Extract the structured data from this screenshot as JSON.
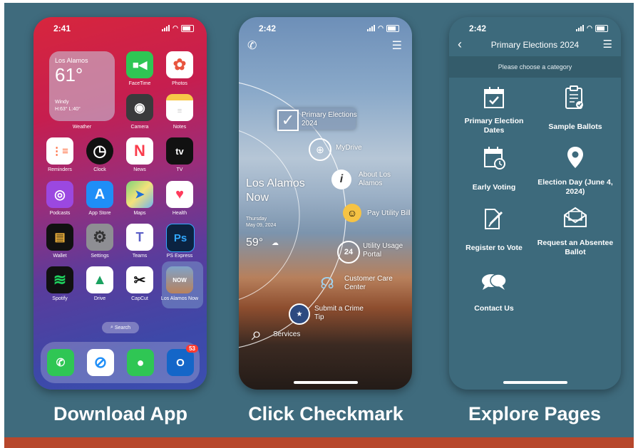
{
  "captions": [
    "Download App",
    "Click Checkmark",
    "Explore Pages"
  ],
  "phone1": {
    "time": "2:41",
    "weather": {
      "city": "Los Alamos",
      "temp": "61°",
      "condition": "Windy",
      "hilo": "H:63° L:40°",
      "label": "Weather"
    },
    "apps": [
      {
        "label": "FaceTime"
      },
      {
        "label": "Photos"
      },
      {
        "label": "Camera"
      },
      {
        "label": "Notes"
      },
      {
        "label": "Reminders"
      },
      {
        "label": "Clock"
      },
      {
        "label": "News"
      },
      {
        "label": "TV"
      },
      {
        "label": "Podcasts"
      },
      {
        "label": "App Store"
      },
      {
        "label": "Maps"
      },
      {
        "label": "Health"
      },
      {
        "label": "Wallet"
      },
      {
        "label": "Settings"
      },
      {
        "label": "Teams"
      },
      {
        "label": "PS Express"
      },
      {
        "label": "Spotify"
      },
      {
        "label": "Drive"
      },
      {
        "label": "CapCut"
      },
      {
        "label": "Los Alamos Now"
      }
    ],
    "search_label": "Search",
    "dock_badge": "53",
    "tv_text": "tv",
    "ps_text": "Ps"
  },
  "phone2": {
    "time": "2:42",
    "app_title": "Los Alamos Now",
    "date": "Thursday",
    "date2": "May 09, 2024",
    "temp": "59°",
    "menu": [
      "Primary Elections 2024",
      "MyDrive",
      "About Los Alamos",
      "Pay Utility Bill",
      "Utility Usage Portal",
      "Customer Care Center",
      "Submit a Crime Tip",
      "Services"
    ]
  },
  "phone3": {
    "time": "2:42",
    "title": "Primary Elections 2024",
    "subtitle": "Please choose a category",
    "categories": [
      "Primary Election Dates",
      "Sample Ballots",
      "Early Voting",
      "Election Day (June 4, 2024)",
      "Register to Vote",
      "Request an Absentee Ballot",
      "Contact Us"
    ]
  },
  "colors": {
    "background": "#3f6b7d",
    "accent_bar": "#b7472c",
    "panel": "#3d6a7c"
  }
}
